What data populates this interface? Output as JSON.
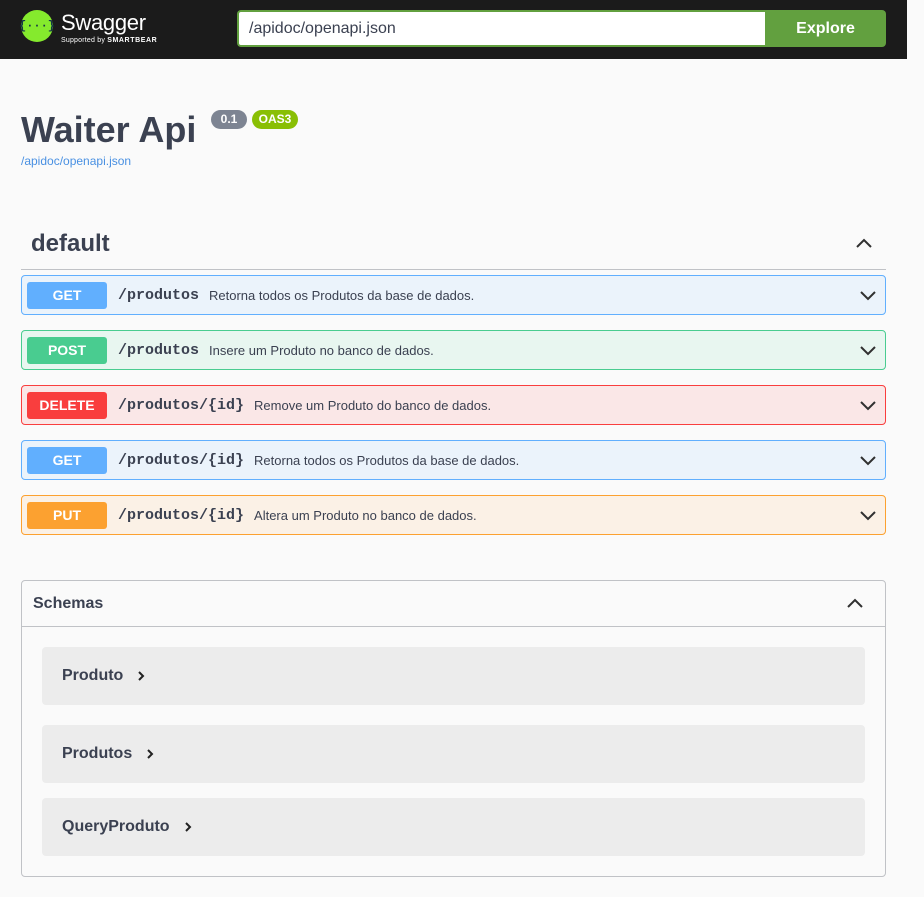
{
  "topbar": {
    "logo_symbol": "{···}",
    "logo_name": "Swagger",
    "logo_sub_prefix": "Supported by",
    "logo_sub_brand": "SMARTBEAR",
    "url_value": "/apidoc/openapi.json",
    "explore_label": "Explore",
    "accent_color": "#62a03f"
  },
  "info": {
    "title": "Waiter Api",
    "version": "0.1",
    "oas_badge": "OAS3",
    "spec_url": "/apidoc/openapi.json"
  },
  "tag": {
    "name": "default",
    "expanded": true
  },
  "operations": [
    {
      "method": "GET",
      "path": "/produtos",
      "summary": "Retorna todos os Produtos da base de dados.",
      "color": "#61affe",
      "bg": "#ebf3fb"
    },
    {
      "method": "POST",
      "path": "/produtos",
      "summary": "Insere um Produto no banco de dados.",
      "color": "#49cc90",
      "bg": "#e8f6f0"
    },
    {
      "method": "DELETE",
      "path": "/produtos/{id}",
      "summary": "Remove um Produto do banco de dados.",
      "color": "#f93e3e",
      "bg": "#fae7e7"
    },
    {
      "method": "GET",
      "path": "/produtos/{id}",
      "summary": "Retorna todos os Produtos da base de dados.",
      "color": "#61affe",
      "bg": "#ebf3fb"
    },
    {
      "method": "PUT",
      "path": "/produtos/{id}",
      "summary": "Altera um Produto no banco de dados.",
      "color": "#fca130",
      "bg": "#fbf1e6"
    }
  ],
  "schemas": {
    "title": "Schemas",
    "items": [
      "Produto",
      "Produtos",
      "QueryProduto"
    ]
  },
  "icons": {
    "expand": "chevron-down-icon",
    "collapse": "chevron-up-icon",
    "model_expand": "chevron-right-icon"
  }
}
